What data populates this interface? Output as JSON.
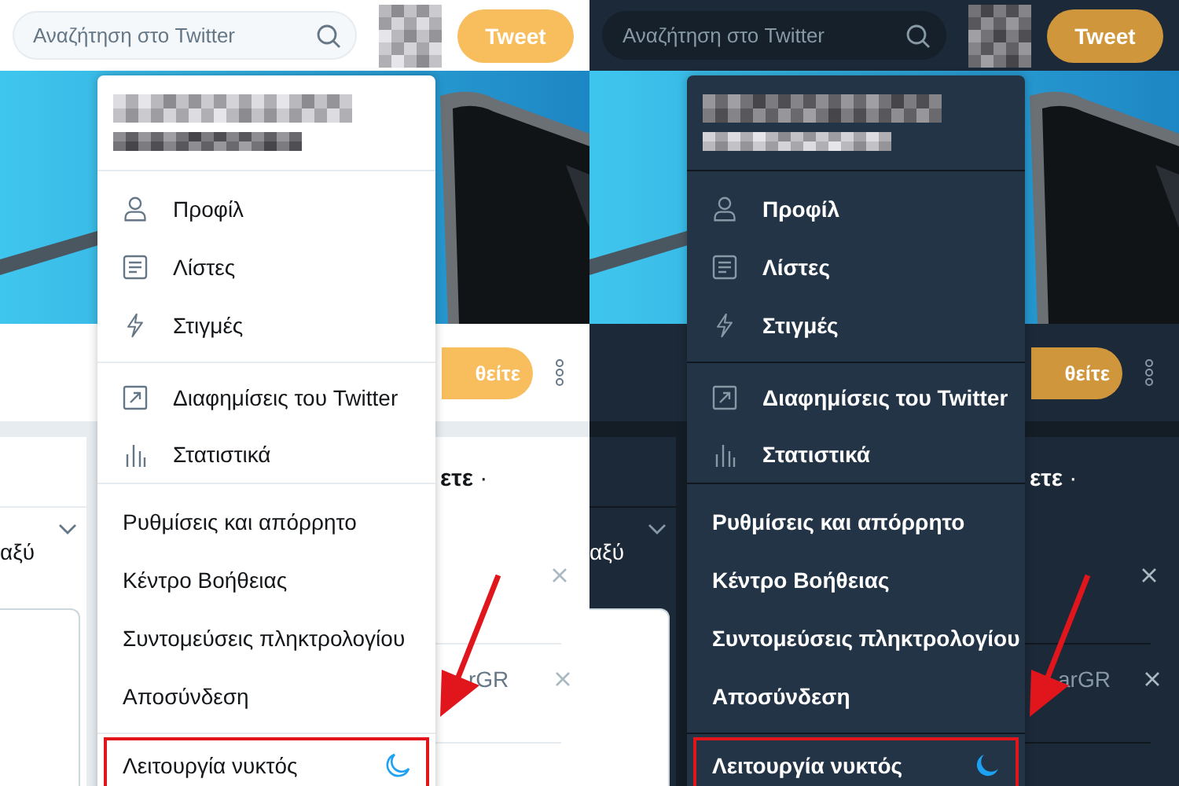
{
  "panels": [
    {
      "kind": "light",
      "search": {
        "placeholder": "Αναζήτηση στο Twitter"
      },
      "tweet_button": "Tweet",
      "follow_button": "θείτε",
      "trends_title": "**ετε** ·",
      "left_text": "αξύ",
      "suggestion_text": "rGR",
      "menu": {
        "sections": [
          {
            "kind": "icons",
            "items": [
              {
                "label": "Προφίλ"
              },
              {
                "label": "Λίστες"
              },
              {
                "label": "Στιγμές"
              }
            ]
          },
          {
            "kind": "icons",
            "items": [
              {
                "label": "Διαφημίσεις του Twitter"
              },
              {
                "label": "Στατιστικά"
              }
            ]
          },
          {
            "kind": "plain",
            "items": [
              {
                "label": "Ρυθμίσεις και απόρρητο"
              },
              {
                "label": "Κέντρο Βοήθειας"
              },
              {
                "label": "Συντομεύσεις πληκτρολογίου"
              },
              {
                "label": "Αποσύνδεση"
              }
            ]
          }
        ],
        "night_mode": {
          "label": "Λειτουργία νυκτός",
          "on": false,
          "highlighted": true
        }
      }
    },
    {
      "kind": "dark",
      "search": {
        "placeholder": "Αναζήτηση στο Twitter"
      },
      "tweet_button": "Tweet",
      "follow_button": "θείτε",
      "trends_title": "**ετε** ·",
      "left_text": "αξύ",
      "suggestion_text": "arGR",
      "menu": {
        "sections": [
          {
            "kind": "icons",
            "items": [
              {
                "label": "Προφίλ"
              },
              {
                "label": "Λίστες"
              },
              {
                "label": "Στιγμές"
              }
            ]
          },
          {
            "kind": "icons",
            "items": [
              {
                "label": "Διαφημίσεις του Twitter"
              },
              {
                "label": "Στατιστικά"
              }
            ]
          },
          {
            "kind": "plain",
            "items": [
              {
                "label": "Ρυθμίσεις και απόρρητο"
              },
              {
                "label": "Κέντρο Βοήθειας"
              },
              {
                "label": "Συντομεύσεις πληκτρολογίου"
              },
              {
                "label": "Αποσύνδεση"
              }
            ]
          }
        ],
        "night_mode": {
          "label": "Λειτουργία νυκτός",
          "on": true,
          "highlighted": true
        }
      }
    }
  ]
}
